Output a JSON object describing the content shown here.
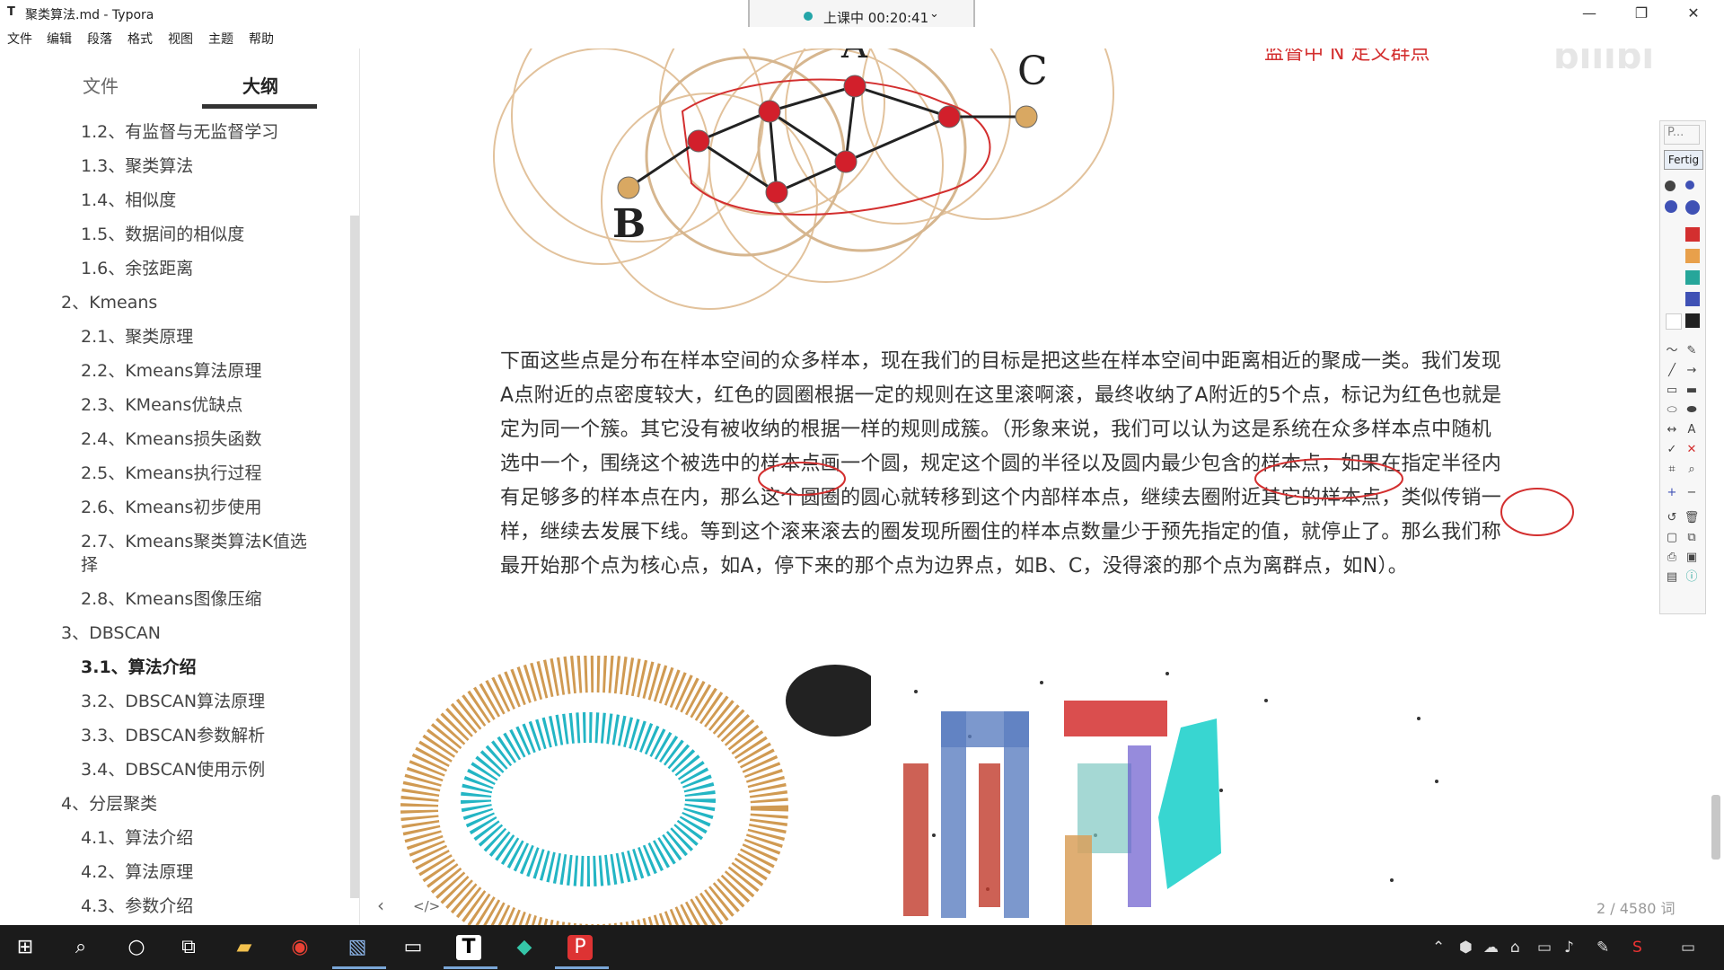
{
  "window": {
    "title": "聚类算法.md - Typora",
    "app_icon": "T",
    "minimize": "—",
    "maximize": "❐",
    "close": "✕"
  },
  "recording": {
    "label": "上课中 00:20:41",
    "chevron": "⌄"
  },
  "menu": [
    "文件",
    "编辑",
    "段落",
    "格式",
    "视图",
    "主题",
    "帮助"
  ],
  "sidebar": {
    "tabs": [
      "文件",
      "大纲"
    ],
    "active_tab": "大纲",
    "outline": [
      {
        "label": "1.2、有监督与无监督学习",
        "level": 2,
        "active": false
      },
      {
        "label": "1.3、聚类算法",
        "level": 2,
        "active": false
      },
      {
        "label": "1.4、相似度",
        "level": 2,
        "active": false
      },
      {
        "label": "1.5、数据间的相似度",
        "level": 2,
        "active": false
      },
      {
        "label": "1.6、余弦距离",
        "level": 2,
        "active": false
      },
      {
        "label": "2、Kmeans",
        "level": 1,
        "active": false
      },
      {
        "label": "2.1、聚类原理",
        "level": 2,
        "active": false
      },
      {
        "label": "2.2、Kmeans算法原理",
        "level": 2,
        "active": false
      },
      {
        "label": "2.3、KMeans优缺点",
        "level": 2,
        "active": false
      },
      {
        "label": "2.4、Kmeans损失函数",
        "level": 2,
        "active": false
      },
      {
        "label": "2.5、Kmeans执行过程",
        "level": 2,
        "active": false
      },
      {
        "label": "2.6、Kmeans初步使用",
        "level": 2,
        "active": false
      },
      {
        "label": "2.7、Kmeans聚类算法K值选择",
        "level": 2,
        "active": false
      },
      {
        "label": "2.8、Kmeans图像压缩",
        "level": 2,
        "active": false
      },
      {
        "label": "3、DBSCAN",
        "level": 1,
        "active": false
      },
      {
        "label": "3.1、算法介绍",
        "level": 2,
        "active": true
      },
      {
        "label": "3.2、DBSCAN算法原理",
        "level": 2,
        "active": false
      },
      {
        "label": "3.3、DBSCAN参数解析",
        "level": 2,
        "active": false
      },
      {
        "label": "3.4、DBSCAN使用示例",
        "level": 2,
        "active": false
      },
      {
        "label": "4、分层聚类",
        "level": 1,
        "active": false
      },
      {
        "label": "4.1、算法介绍",
        "level": 2,
        "active": false
      },
      {
        "label": "4.2、算法原理",
        "level": 2,
        "active": false
      },
      {
        "label": "4.3、参数介绍",
        "level": 2,
        "active": false
      }
    ]
  },
  "content": {
    "diagram_labels": {
      "a": "A",
      "b": "B",
      "c": "C"
    },
    "handwritten_note": "监督中 N 定义群点",
    "watermark": "bilibili",
    "paragraph_lines": [
      "下面这些点是分布在样本空间的众多样本，现在我们的目标是把这些在样本空间中距离相近的聚成一类。我们发现",
      "A点附近的点密度较大，红色的圆圈根据一定的规则在这里滚啊滚，最终收纳了A附近的5个点，标记为红色也就是",
      "定为同一个簇。其它没有被收纳的根据一样的规则成簇。（形象来说，我们可以认为这是系统在众多样本点中随机",
      "选中一个，围绕这个被选中的样本点画一个圆，规定这个圆的半径以及圆内最少包含的样本点，如果在指定半径内",
      "有足够多的样本点在内，那么这个圆圈的圆心就转移到这个内部样本点，继续去圈附近其它的样本点，类似传销一",
      "样，继续去发展下线。等到这个滚来滚去的圈发现所圈住的样本点数量少于预先指定的值，就停止了。那么我们称",
      "最开始那个点为核心点，如A，停下来的那个点为边界点，如B、C，没得滚的那个点为离群点，如N）。"
    ]
  },
  "footer": {
    "back_icon": "‹",
    "source_icon": "</>",
    "word_count": "2 / 4580 词"
  },
  "palette": {
    "pin_label": "P...",
    "done_label": "Fertig",
    "colors": [
      "#d32f2f",
      "#e8a04b",
      "#26a69a",
      "#3f51b5",
      "#212121",
      "#ffffff"
    ]
  },
  "taskbar": {
    "icons": [
      "windows-start",
      "search",
      "cortana",
      "task-view",
      "file-explorer",
      "chrome",
      "paint",
      "terminal",
      "typora",
      "app-green",
      "pdf"
    ]
  }
}
